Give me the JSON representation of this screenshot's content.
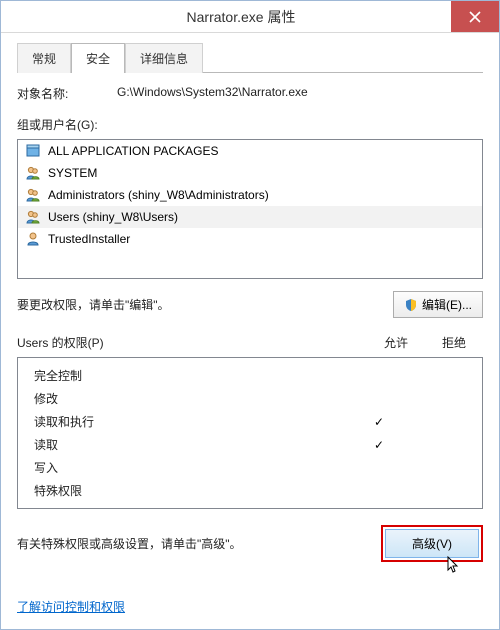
{
  "window": {
    "title": "Narrator.exe 属性"
  },
  "tabs": {
    "general": "常规",
    "security": "安全",
    "details": "详细信息",
    "active_index": 1
  },
  "object": {
    "label": "对象名称:",
    "value": "G:\\Windows\\System32\\Narrator.exe"
  },
  "groups": {
    "label": "组或用户名(G):",
    "items": [
      {
        "icon": "package-icon",
        "name": "ALL APPLICATION PACKAGES"
      },
      {
        "icon": "users-icon",
        "name": "SYSTEM"
      },
      {
        "icon": "users-icon",
        "name": "Administrators (shiny_W8\\Administrators)"
      },
      {
        "icon": "users-icon",
        "name": "Users (shiny_W8\\Users)"
      },
      {
        "icon": "user-icon",
        "name": "TrustedInstaller"
      }
    ],
    "selected_index": 3
  },
  "edit_hint": "要更改权限，请单击\"编辑\"。",
  "buttons": {
    "edit": "编辑(E)...",
    "advanced": "高级(V)"
  },
  "permissions": {
    "header_left": "Users 的权限(P)",
    "col_allow": "允许",
    "col_deny": "拒绝",
    "rows": [
      {
        "name": "完全控制",
        "allow": "",
        "deny": ""
      },
      {
        "name": "修改",
        "allow": "",
        "deny": ""
      },
      {
        "name": "读取和执行",
        "allow": "✓",
        "deny": ""
      },
      {
        "name": "读取",
        "allow": "✓",
        "deny": ""
      },
      {
        "name": "写入",
        "allow": "",
        "deny": ""
      },
      {
        "name": "特殊权限",
        "allow": "",
        "deny": ""
      }
    ]
  },
  "advanced_hint": "有关特殊权限或高级设置，请单击\"高级\"。",
  "link_text": "了解访问控制和权限"
}
